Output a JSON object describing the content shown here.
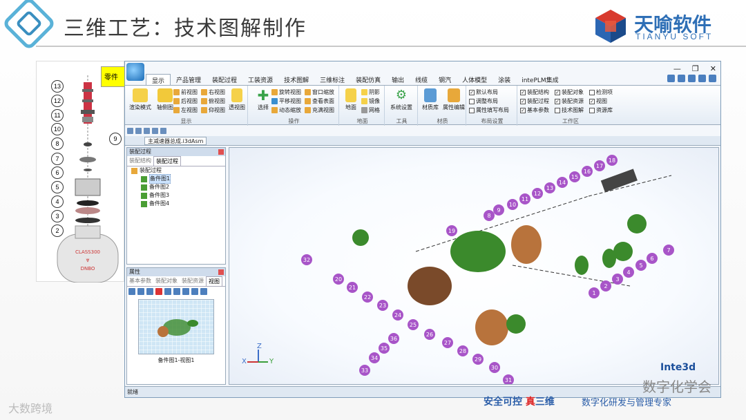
{
  "slide": {
    "title": "三维工艺：技术图解制作",
    "logo_text": "天喻软件",
    "logo_sub": "TIANYU SOFT"
  },
  "valve": {
    "yellow_button": "零件",
    "callouts": [
      "13",
      "12",
      "11",
      "10",
      "9",
      "8",
      "7",
      "6",
      "5",
      "4",
      "3",
      "2"
    ],
    "body_text_1": "CLASS300",
    "body_text_2": "DNBO"
  },
  "app": {
    "window_controls": [
      "—",
      "❐",
      "✕"
    ],
    "tabs": [
      "显示",
      "产品管理",
      "装配过程",
      "工装资源",
      "技术图解",
      "三维标注",
      "装配仿真",
      "输出",
      "线缆",
      "钢汽",
      "人体模型",
      "涂装",
      "intePLM集成"
    ],
    "active_tab": "显示",
    "ribbon": {
      "display_group": {
        "label": "显示",
        "big_buttons": [
          "渲染模式",
          "轴侧图"
        ],
        "views": [
          "前视图",
          "右视图",
          "后视图",
          "俯视图",
          "左视图",
          "仰视图"
        ],
        "perspective": "透视图"
      },
      "operate_group": {
        "label": "操作",
        "select": "选择",
        "buttons": [
          "旋转视图",
          "窗口缩放",
          "平移视图",
          "查看表面",
          "动态缩放",
          "充满视图"
        ]
      },
      "ground_group": {
        "label": "地面",
        "big": "地面",
        "buttons": [
          "阴影",
          "镜像",
          "网格"
        ]
      },
      "tools_group": {
        "label": "工具",
        "button": "系统设置"
      },
      "material_group": {
        "label": "材质",
        "buttons": [
          "材质库",
          "属性编辑"
        ]
      },
      "layout_group": {
        "label": "布局设置",
        "items": [
          {
            "label": "默认布局",
            "checked": true
          },
          {
            "label": "调整布局",
            "checked": false
          },
          {
            "label": "属性填写布局",
            "checked": false
          }
        ]
      },
      "workspace_group": {
        "label": "工作区",
        "items": [
          {
            "label": "装配结构",
            "checked": true
          },
          {
            "label": "装配对象",
            "checked": true
          },
          {
            "label": "检测项",
            "checked": false
          },
          {
            "label": "装配过程",
            "checked": true
          },
          {
            "label": "装配资源",
            "checked": true
          },
          {
            "label": "视图",
            "checked": true
          },
          {
            "label": "基本参数",
            "checked": true
          },
          {
            "label": "技术图解",
            "checked": false
          },
          {
            "label": "资源库",
            "checked": false
          }
        ]
      }
    },
    "document_tab": "主减速器总成.i3dAsm",
    "assembly_pane": {
      "title": "装配过程",
      "tabs": [
        "装配结构",
        "装配过程"
      ],
      "active_tab": "装配过程",
      "root": "装配过程",
      "items": [
        "备件图1",
        "备件图2",
        "备件图3",
        "备件图4"
      ],
      "selected": "备件图1"
    },
    "property_pane": {
      "title": "属性",
      "tabs": [
        "基本参数",
        "装配对象",
        "装配资源",
        "视图"
      ],
      "active_tab": "视图",
      "thumb_caption": "备件图1-视图1"
    },
    "status": "就绪",
    "viewport_logo": "Inte3d",
    "axis_labels": [
      "Z",
      "X",
      "Y"
    ]
  },
  "part_labels": [
    "1",
    "2",
    "3",
    "4",
    "5",
    "6",
    "7",
    "8",
    "9",
    "10",
    "11",
    "12",
    "13",
    "14",
    "15",
    "16",
    "17",
    "18",
    "19",
    "20",
    "21",
    "22",
    "23",
    "24",
    "25",
    "26",
    "27",
    "28",
    "29",
    "30",
    "31",
    "32",
    "33",
    "34",
    "35",
    "36"
  ],
  "footer": {
    "slogan_a": "安全可控",
    "slogan_b": "真",
    "slogan_c": "三维",
    "slogan2": "数字化研发与管理专家",
    "watermark_left": "大数跨境",
    "watermark_right": "数字化学会"
  },
  "colors": {
    "accent": "#2e6fb6",
    "part_green": "#3b8a2c",
    "part_bronze": "#b8733c",
    "callout_purple": "#a855c8"
  }
}
